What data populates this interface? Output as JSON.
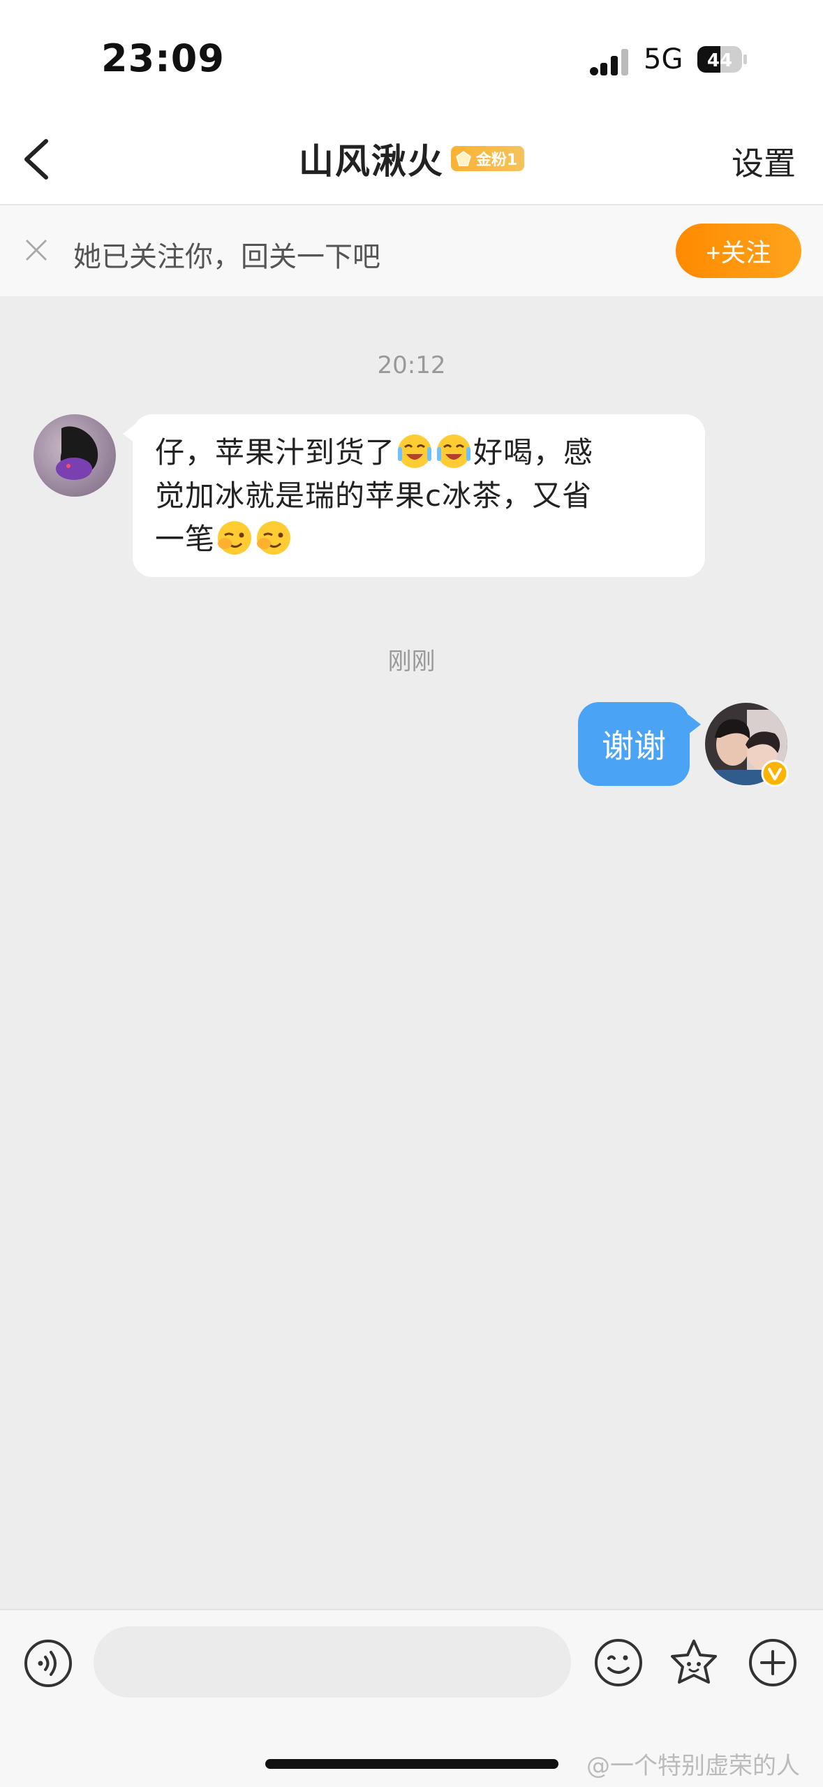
{
  "status_bar": {
    "time": "23:09",
    "network": "5G",
    "battery": "44"
  },
  "header": {
    "title": "山风湫火",
    "fan_badge": "金粉1",
    "settings_label": "设置"
  },
  "follow_banner": {
    "text": "她已关注你，回关一下吧",
    "follow_button": "+关注"
  },
  "chat": {
    "messages": [
      {
        "timestamp": "20:12",
        "direction": "incoming",
        "line1": "仔，苹果汁到货了",
        "line1_after": "好喝，感",
        "line2": "觉加冰就是瑞的苹果c冰茶，又省",
        "line3": "一笔"
      },
      {
        "timestamp": "刚刚",
        "direction": "outgoing",
        "text": "谢谢"
      }
    ]
  },
  "input_bar": {
    "placeholder": ""
  },
  "watermark": "@一个特别虚荣的人",
  "colors": {
    "accent_orange": "#ff8a00",
    "outgoing_bubble": "#4aa3f5",
    "gold_badge": "#f9b234"
  },
  "icons": [
    "back-icon",
    "close-icon",
    "voice-icon",
    "smile-icon",
    "sticker-icon",
    "plus-icon",
    "verified-icon"
  ]
}
